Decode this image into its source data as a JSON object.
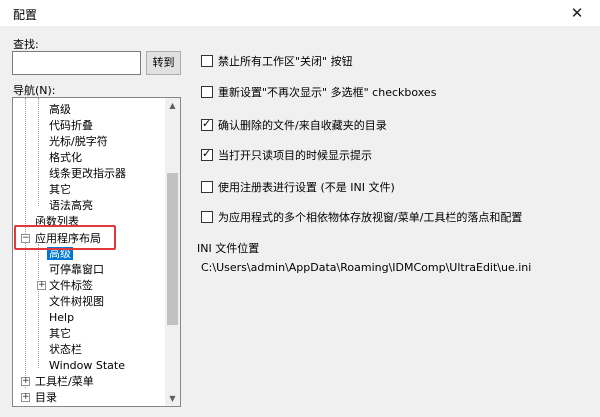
{
  "window": {
    "title": "配置",
    "close_icon": "close-icon"
  },
  "search": {
    "label": "查找:",
    "value": "",
    "placeholder": "",
    "goto_label": "转到"
  },
  "nav": {
    "label": "导航(N):"
  },
  "tree": [
    {
      "label": "高级",
      "level": 2,
      "selected": false
    },
    {
      "label": "代码折叠",
      "level": 2,
      "selected": false
    },
    {
      "label": "光标/脱字符",
      "level": 2,
      "selected": false
    },
    {
      "label": "格式化",
      "level": 2,
      "selected": false
    },
    {
      "label": "线条更改指示器",
      "level": 2,
      "selected": false
    },
    {
      "label": "其它",
      "level": 2,
      "selected": false
    },
    {
      "label": "语法高亮",
      "level": 2,
      "selected": false
    },
    {
      "label": "函数列表",
      "level": 1,
      "selected": false
    },
    {
      "label": "应用程序布局",
      "level": 1,
      "selected": false,
      "expander": "−"
    },
    {
      "label": "高级",
      "level": 2,
      "selected": true
    },
    {
      "label": "可停靠窗口",
      "level": 2,
      "selected": false
    },
    {
      "label": "文件标签",
      "level": 2,
      "selected": false,
      "expander": "+"
    },
    {
      "label": "文件树视图",
      "level": 2,
      "selected": false
    },
    {
      "label": "Help",
      "level": 2,
      "selected": false
    },
    {
      "label": "其它",
      "level": 2,
      "selected": false
    },
    {
      "label": "状态栏",
      "level": 2,
      "selected": false
    },
    {
      "label": "Window State",
      "level": 2,
      "selected": false
    },
    {
      "label": "工具栏/菜单",
      "level": 1,
      "selected": false,
      "expander": "+"
    },
    {
      "label": "目录",
      "level": 1,
      "selected": false,
      "expander": "+"
    }
  ],
  "options": [
    {
      "label": "禁止所有工作区\"关闭\" 按钮",
      "checked": false
    },
    {
      "label": "重新设置\"不再次显示\" 多选框\" checkboxes",
      "checked": false
    },
    {
      "label": "确认删除的文件/来自收藏夹的目录",
      "checked": true
    },
    {
      "label": "当打开只读项目的时候显示提示",
      "checked": true
    },
    {
      "label": "使用注册表进行设置 (不是 INI 文件)",
      "checked": false
    },
    {
      "label": "为应用程式的多个相依物体存放视窗/菜单/工具栏的落点和配置",
      "checked": false
    }
  ],
  "ini": {
    "label": "INI 文件位置",
    "path": "C:\\Users\\admin\\AppData\\Roaming\\IDMComp\\UltraEdit\\ue.ini"
  }
}
